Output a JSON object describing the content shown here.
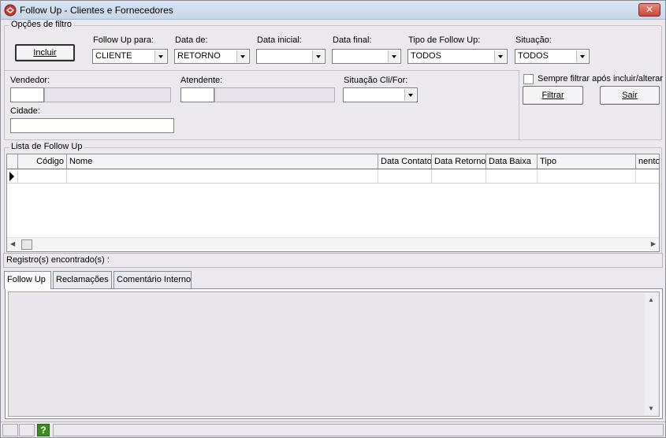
{
  "window": {
    "title": "Follow Up - Clientes e Fornecedores",
    "close_label": "✕"
  },
  "filter": {
    "legend": "Opções de filtro",
    "incluir_label": "Incluir",
    "followup_para": {
      "label": "Follow Up para:",
      "value": "CLIENTE"
    },
    "data_de": {
      "label": "Data de:",
      "value": "RETORNO"
    },
    "data_inicial": {
      "label": "Data inicial:",
      "value": ""
    },
    "data_final": {
      "label": "Data final:",
      "value": ""
    },
    "tipo_followup": {
      "label": "Tipo de Follow Up:",
      "value": "TODOS"
    },
    "situacao": {
      "label": "Situação:",
      "value": "TODOS"
    },
    "vendedor_label": "Vendedor:",
    "atendente_label": "Atendente:",
    "situacao_cli_label": "Situação Cli/For:",
    "cidade_label": "Cidade:",
    "sempre_filtrar_label": "Sempre filtrar após incluir/alterar",
    "filtrar_label": "Filtrar",
    "sair_label": "Sair"
  },
  "list": {
    "legend": "Lista de Follow Up",
    "columns": [
      "Código",
      "Nome",
      "Data Contato",
      "Data Retorno",
      "Data Baixa",
      "Tipo",
      "nento"
    ],
    "records_label": "Registro(s) encontrado(s) :"
  },
  "tabs": [
    "Follow Up",
    "Reclamações",
    "Comentário Interno"
  ],
  "status": {
    "help_icon": "?"
  }
}
